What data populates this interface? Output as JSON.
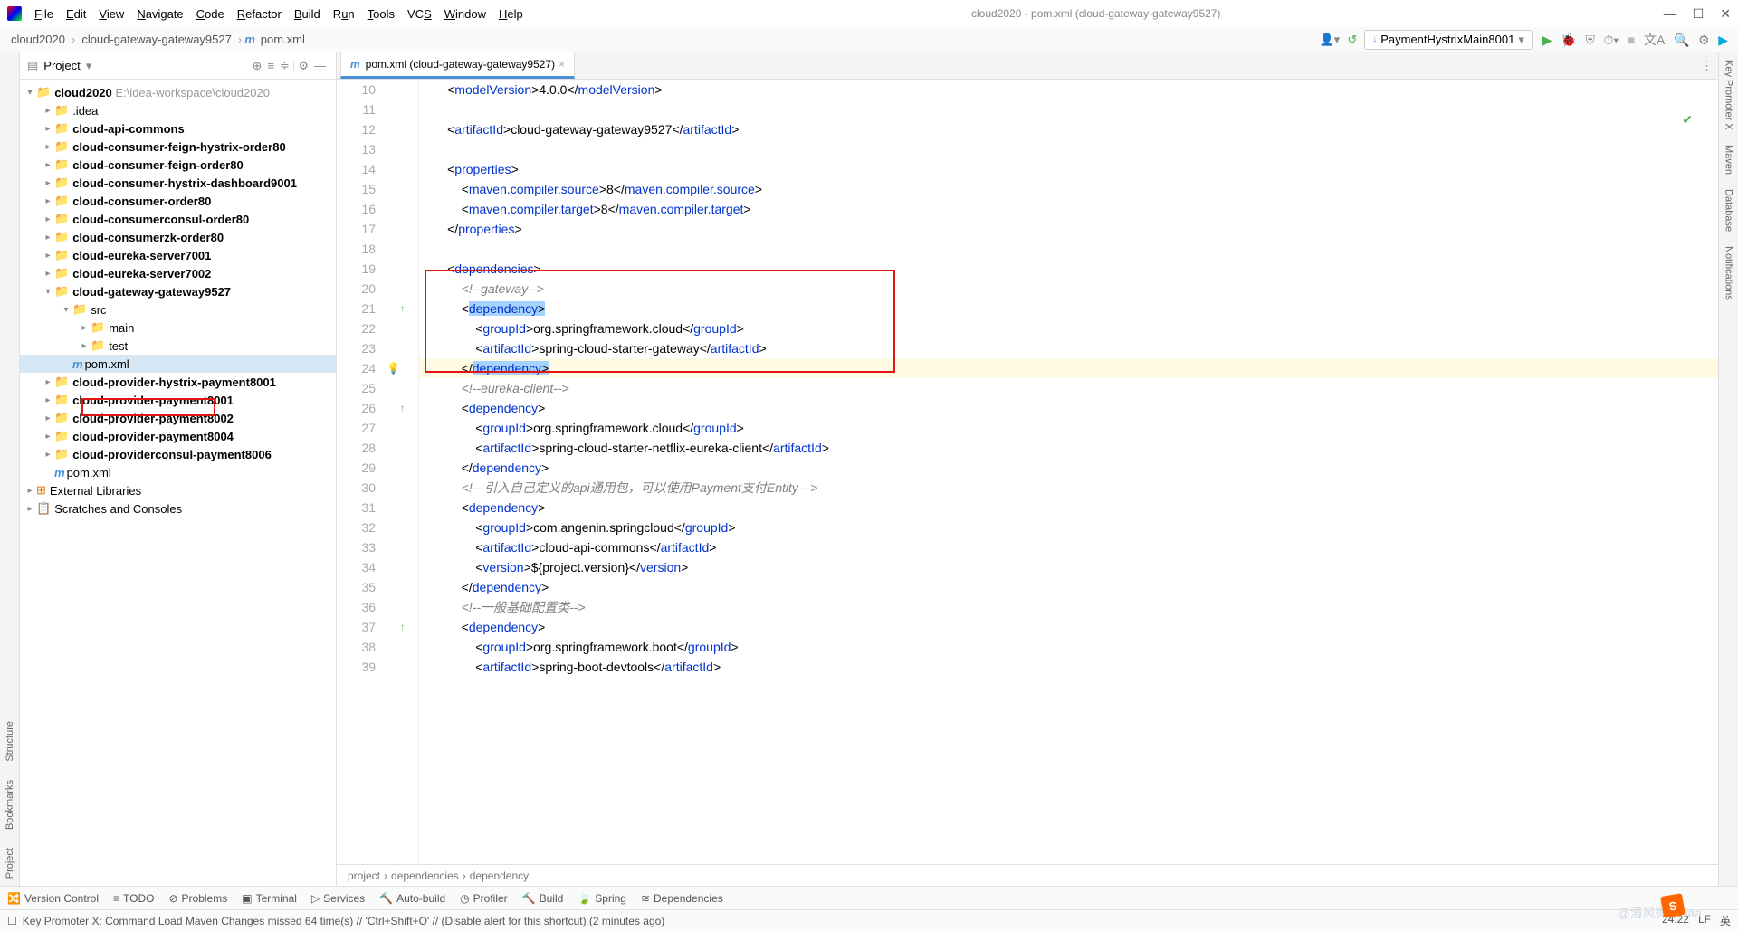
{
  "window": {
    "title": "cloud2020 - pom.xml (cloud-gateway-gateway9527)"
  },
  "menu": [
    "File",
    "Edit",
    "View",
    "Navigate",
    "Code",
    "Refactor",
    "Build",
    "Run",
    "Tools",
    "VCS",
    "Window",
    "Help"
  ],
  "breadcrumbs": {
    "p0": "cloud2020",
    "p1": "cloud-gateway-gateway9527",
    "p2": "pom.xml"
  },
  "run_config": "PaymentHystrixMain8001",
  "panel": {
    "title": "Project"
  },
  "tree": {
    "root": "cloud2020",
    "root_path": "E:\\idea-workspace\\cloud2020",
    "items": [
      ".idea",
      "cloud-api-commons",
      "cloud-consumer-feign-hystrix-order80",
      "cloud-consumer-feign-order80",
      "cloud-consumer-hystrix-dashboard9001",
      "cloud-consumer-order80",
      "cloud-consumerconsul-order80",
      "cloud-consumerzk-order80",
      "cloud-eureka-server7001",
      "cloud-eureka-server7002",
      "cloud-gateway-gateway9527",
      "cloud-provider-hystrix-payment8001",
      "cloud-provider-payment8001",
      "cloud-provider-payment8002",
      "cloud-provider-payment8004",
      "cloud-providerconsul-payment8006"
    ],
    "src": "src",
    "main": "main",
    "test": "test",
    "pom": "pom.xml",
    "root_pom": "pom.xml",
    "ext_lib": "External Libraries",
    "scratches": "Scratches and Consoles"
  },
  "tab": {
    "label": "pom.xml (cloud-gateway-gateway9527)"
  },
  "code": {
    "l10": {
      "pre": "        <",
      "t1": "modelVersion",
      "mid1": ">",
      "txt": "4.0.0",
      "mid2": "</",
      "t2": "modelVersion",
      "end": ">"
    },
    "l12": {
      "pre": "        <",
      "t1": "artifactId",
      "mid1": ">",
      "txt": "cloud-gateway-gateway9527",
      "mid2": "</",
      "t2": "artifactId",
      "end": ">"
    },
    "l14": {
      "pre": "        <",
      "t1": "properties",
      "end": ">"
    },
    "l15": {
      "pre": "            <",
      "t1": "maven.compiler.source",
      "mid1": ">",
      "txt": "8",
      "mid2": "</",
      "t2": "maven.compiler.source",
      "end": ">"
    },
    "l16": {
      "pre": "            <",
      "t1": "maven.compiler.target",
      "mid1": ">",
      "txt": "8",
      "mid2": "</",
      "t2": "maven.compiler.target",
      "end": ">"
    },
    "l17": {
      "pre": "        </",
      "t1": "properties",
      "end": ">"
    },
    "l19": {
      "pre": "        <",
      "t1": "dependencies",
      "end": ">"
    },
    "l20": {
      "c": "            <!--gateway-->"
    },
    "l21": {
      "pre": "            <",
      "t1": "dependency",
      "end": ">"
    },
    "l22": {
      "pre": "                <",
      "t1": "groupId",
      "mid1": ">",
      "txt": "org.springframework.cloud",
      "mid2": "</",
      "t2": "groupId",
      "end": ">"
    },
    "l23": {
      "pre": "                <",
      "t1": "artifactId",
      "mid1": ">",
      "txt": "spring-cloud-starter-gateway",
      "mid2": "</",
      "t2": "artifactId",
      "end": ">"
    },
    "l24": {
      "pre": "            </",
      "t1": "dependency",
      "end": ">"
    },
    "l25": {
      "c": "            <!--eureka-client-->"
    },
    "l26": {
      "pre": "            <",
      "t1": "dependency",
      "end": ">"
    },
    "l27": {
      "pre": "                <",
      "t1": "groupId",
      "mid1": ">",
      "txt": "org.springframework.cloud",
      "mid2": "</",
      "t2": "groupId",
      "end": ">"
    },
    "l28": {
      "pre": "                <",
      "t1": "artifactId",
      "mid1": ">",
      "txt": "spring-cloud-starter-netflix-eureka-client",
      "mid2": "</",
      "t2": "artifactId",
      "end": ">"
    },
    "l29": {
      "pre": "            </",
      "t1": "dependency",
      "end": ">"
    },
    "l30": {
      "c": "            <!-- 引入自己定义的api通用包，可以使用Payment支付Entity -->"
    },
    "l31": {
      "pre": "            <",
      "t1": "dependency",
      "end": ">"
    },
    "l32": {
      "pre": "                <",
      "t1": "groupId",
      "mid1": ">",
      "txt": "com.angenin.springcloud",
      "mid2": "</",
      "t2": "groupId",
      "end": ">"
    },
    "l33": {
      "pre": "                <",
      "t1": "artifactId",
      "mid1": ">",
      "txt": "cloud-api-commons",
      "mid2": "</",
      "t2": "artifactId",
      "end": ">"
    },
    "l34": {
      "pre": "                <",
      "t1": "version",
      "mid1": ">",
      "txt": "${project.version}",
      "mid2": "</",
      "t2": "version",
      "end": ">"
    },
    "l35": {
      "pre": "            </",
      "t1": "dependency",
      "end": ">"
    },
    "l36": {
      "c": "            <!--一般基础配置类-->"
    },
    "l37": {
      "pre": "            <",
      "t1": "dependency",
      "end": ">"
    },
    "l38": {
      "pre": "                <",
      "t1": "groupId",
      "mid1": ">",
      "txt": "org.springframework.boot",
      "mid2": "</",
      "t2": "groupId",
      "end": ">"
    },
    "l39": {
      "pre": "                <",
      "t1": "artifactId",
      "mid1": ">",
      "txt": "spring-boot-devtools",
      "mid2": "</",
      "t2": "artifactId",
      "end": ">"
    }
  },
  "editor_crumbs": {
    "p0": "project",
    "p1": "dependencies",
    "p2": "dependency"
  },
  "tools": [
    "Version Control",
    "TODO",
    "Problems",
    "Terminal",
    "Services",
    "Auto-build",
    "Profiler",
    "Build",
    "Spring",
    "Dependencies"
  ],
  "status": {
    "msg": "Key Promoter X: Command Load Maven Changes missed 64 time(s) // 'Ctrl+Shift+O' // (Disable alert for this shortcut) (2 minutes ago)",
    "pos": "24:22",
    "enc": "LF",
    "lang": "英"
  },
  "right_tools": [
    "Key Promoter X",
    "Maven",
    "Database",
    "Notifications"
  ],
  "left_tools": [
    "Project",
    "Bookmarks",
    "Structure"
  ],
  "watermark": "@清风微凉aaa"
}
